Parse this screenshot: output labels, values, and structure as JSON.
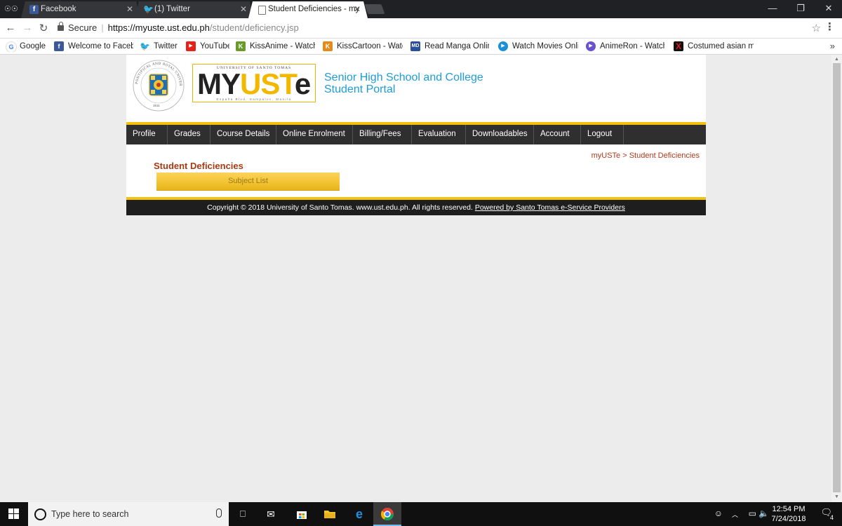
{
  "browser": {
    "tabs": [
      {
        "title": "Facebook",
        "favicon": "facebook-icon",
        "active": false
      },
      {
        "title": "(1) Twitter",
        "favicon": "twitter-icon",
        "active": false
      },
      {
        "title": "Student Deficiencies - my",
        "favicon": "page-icon",
        "active": true
      }
    ],
    "address": {
      "security_label": "Secure",
      "url_host": "https://myuste.ust.edu.ph",
      "url_path": "/student/deficiency.jsp"
    },
    "bookmarks": [
      {
        "label": "Google",
        "icon": "google-icon",
        "color": "#4285f4"
      },
      {
        "label": "Welcome to Faceboo",
        "icon": "facebook-icon",
        "color": "#3b5998"
      },
      {
        "label": "Twitter",
        "icon": "twitter-icon",
        "color": "#1da1f2"
      },
      {
        "label": "YouTube",
        "icon": "youtube-icon",
        "color": "#e62117"
      },
      {
        "label": "KissAnime - Watch &",
        "icon": "kissanime-icon",
        "color": "#6a9a2a"
      },
      {
        "label": "KissCartoon - Watch",
        "icon": "kisscartoon-icon",
        "color": "#e28b1a"
      },
      {
        "label": "Read Manga Online",
        "icon": "manga-icon",
        "color": "#2a4f9e"
      },
      {
        "label": "Watch Movies Onlin",
        "icon": "movies-icon",
        "color": "#1b8fd8"
      },
      {
        "label": "AnimeRon - Watch A",
        "icon": "animeron-icon",
        "color": "#6a4fcf"
      },
      {
        "label": "Costumed asian mo",
        "icon": "x-site-icon",
        "color": "#c01515"
      }
    ],
    "bookmarks_overflow": "»"
  },
  "site": {
    "seal_text": "PONTIFICAL AND ROYAL UNIVERSITY OF SANTO TOMAS MANILA",
    "seal_year": "1611",
    "logo": {
      "top_text": "UNIVERSITY OF SANTO TOMAS",
      "my": "MY",
      "ust": "UST",
      "e": "e",
      "bottom_text": "España Blvd, Sampaloc, Manila"
    },
    "portal_title_line1": "Senior High School and College",
    "portal_title_line2": "Student Portal",
    "nav": [
      "Profile",
      "Grades",
      "Course Details",
      "Online Enrolment",
      "Billing/Fees",
      "Evaluation",
      "Downloadables",
      "Account",
      "Logout"
    ],
    "breadcrumb": "myUSTe > Student Deficiencies",
    "section_title": "Student Deficiencies",
    "subject_list_tab": "Subject List",
    "footer_text": "Copyright © 2018 University of Santo Tomas. www.ust.edu.ph. All rights reserved.",
    "footer_link": "Powered by Santo Tomas e-Service Providers",
    "colors": {
      "accent_gold": "#f4c20d",
      "nav_bg": "#2f2f2f",
      "portal_title": "#1e9dd8",
      "section_title": "#a83a12"
    }
  },
  "taskbar": {
    "search_placeholder": "Type here to search",
    "time": "12:54 PM",
    "date": "7/24/2018",
    "notification_count": "4"
  }
}
